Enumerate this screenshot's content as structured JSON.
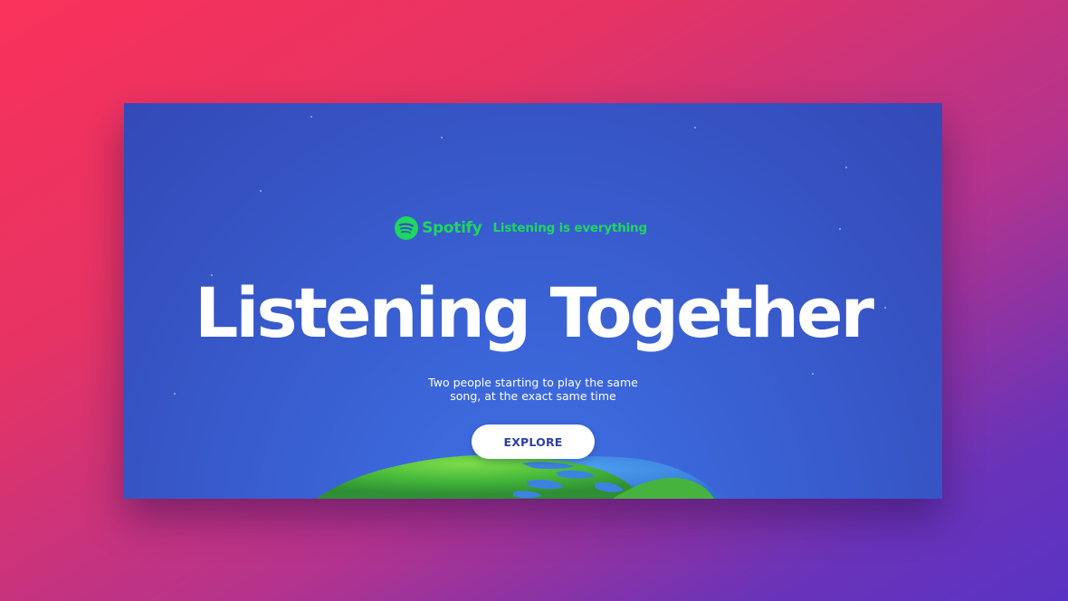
{
  "brand": {
    "name": "Spotify",
    "tagline": "Listening is everything"
  },
  "hero": {
    "title": "Listening Together",
    "subtitle_lines": [
      "Two people starting to play the same",
      "song, at the exact same time"
    ],
    "cta_label": "EXPLORE"
  },
  "colors": {
    "spotify_green": "#1ed760",
    "card_blue": "#3652c2",
    "button_text": "#2f3fa3",
    "background_pink": "#f9325a",
    "background_purple": "#5a33c4"
  },
  "icons": {
    "logo": "spotify-logo-icon",
    "globe": "earth-globe-illustration"
  }
}
